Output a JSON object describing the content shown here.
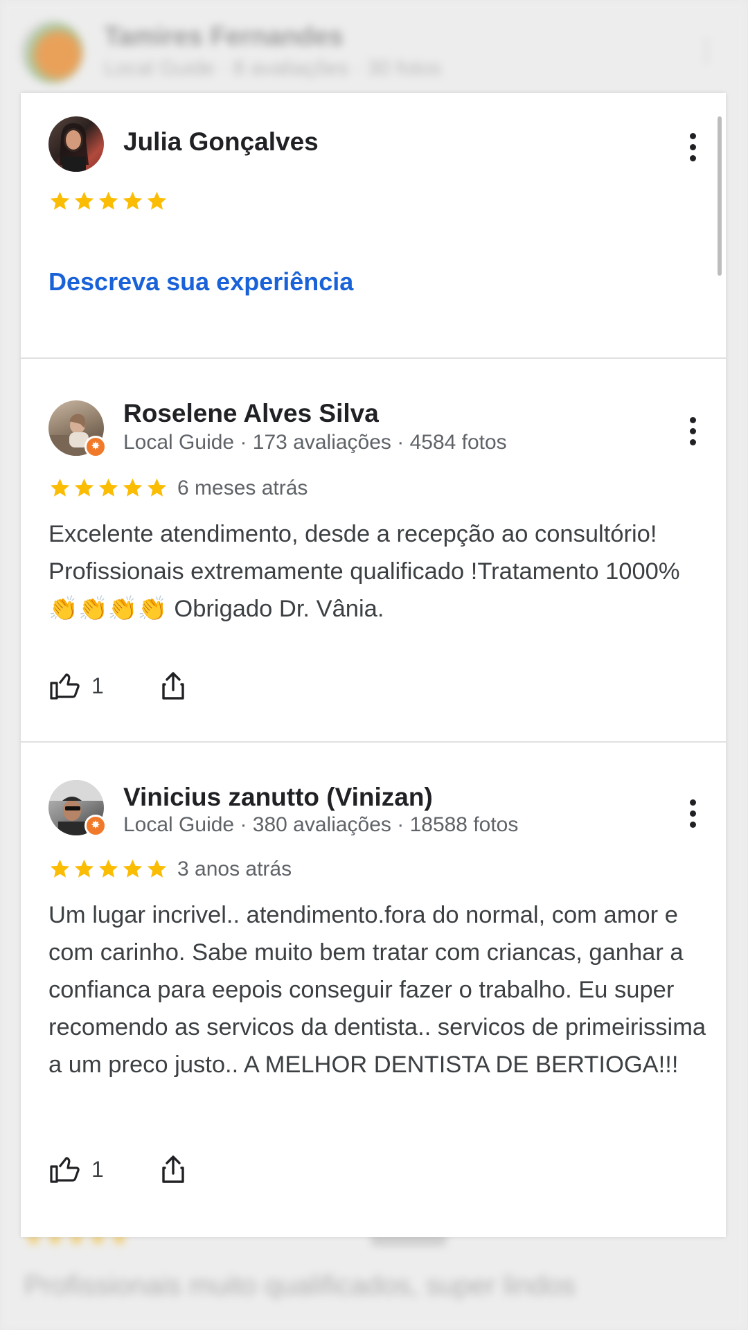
{
  "background": {
    "header_name": "Tamires Fernandes",
    "header_sub": "Local Guide · 8 avaliações · 30 fotos",
    "bottom_text": "Profissionais muito qualificados, super lindos"
  },
  "own_review": {
    "name": "Julia Gonçalves",
    "rating": 5,
    "describe_link": "Descreva sua experiência"
  },
  "reviews": [
    {
      "name": "Roselene Alves Silva",
      "meta": "Local Guide · 173 avaliações · 4584 fotos",
      "rating": 5,
      "time": "6 meses atrás",
      "text": "Excelente atendimento, desde a recepção ao consultório! Profissionais extremamente qualificado !Tratamento 1000% 👏👏👏👏 Obrigado Dr. Vânia.",
      "likes": "1"
    },
    {
      "name": "Vinicius zanutto (Vinizan)",
      "meta": "Local Guide · 380 avaliações · 18588 fotos",
      "rating": 5,
      "time": "3 anos atrás",
      "text": "Um lugar incrivel.. atendimento.fora do normal, com amor e com carinho. Sabe muito bem tratar com criancas, ganhar a confianca para eepois conseguir fazer o trabalho. Eu super recomendo as servicos da dentista.. servicos de primeirissima a um preco justo.. A MELHOR DENTISTA DE BERTIOGA!!!",
      "likes": "1"
    }
  ],
  "colors": {
    "star": "#fbbc04",
    "link": "#1a62d8",
    "badge": "#f07a2a"
  },
  "icons": {
    "menu": "more-vert-icon",
    "like": "thumb-up-icon",
    "share": "share-icon",
    "star": "star-icon",
    "badge": "local-guide-badge-icon"
  }
}
